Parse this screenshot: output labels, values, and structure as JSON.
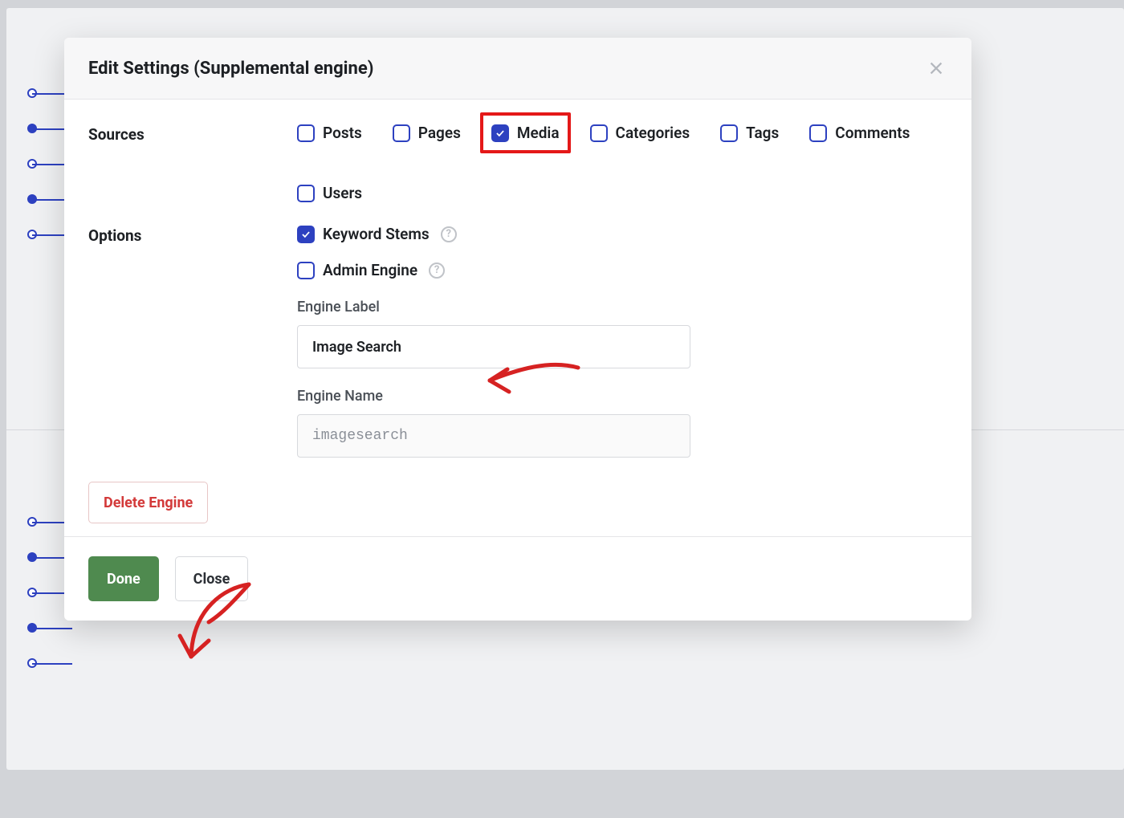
{
  "modal": {
    "title": "Edit Settings (Supplemental engine)"
  },
  "sections": {
    "sources_label": "Sources",
    "options_label": "Options"
  },
  "sources": {
    "posts": "Posts",
    "pages": "Pages",
    "media": "Media",
    "categories": "Categories",
    "tags": "Tags",
    "comments": "Comments",
    "users": "Users"
  },
  "options": {
    "keyword_stems": "Keyword Stems",
    "admin_engine": "Admin Engine"
  },
  "fields": {
    "engine_label": {
      "label": "Engine Label",
      "value": "Image Search"
    },
    "engine_name": {
      "label": "Engine Name",
      "value": "imagesearch"
    }
  },
  "buttons": {
    "delete": "Delete Engine",
    "done": "Done",
    "close": "Close"
  }
}
